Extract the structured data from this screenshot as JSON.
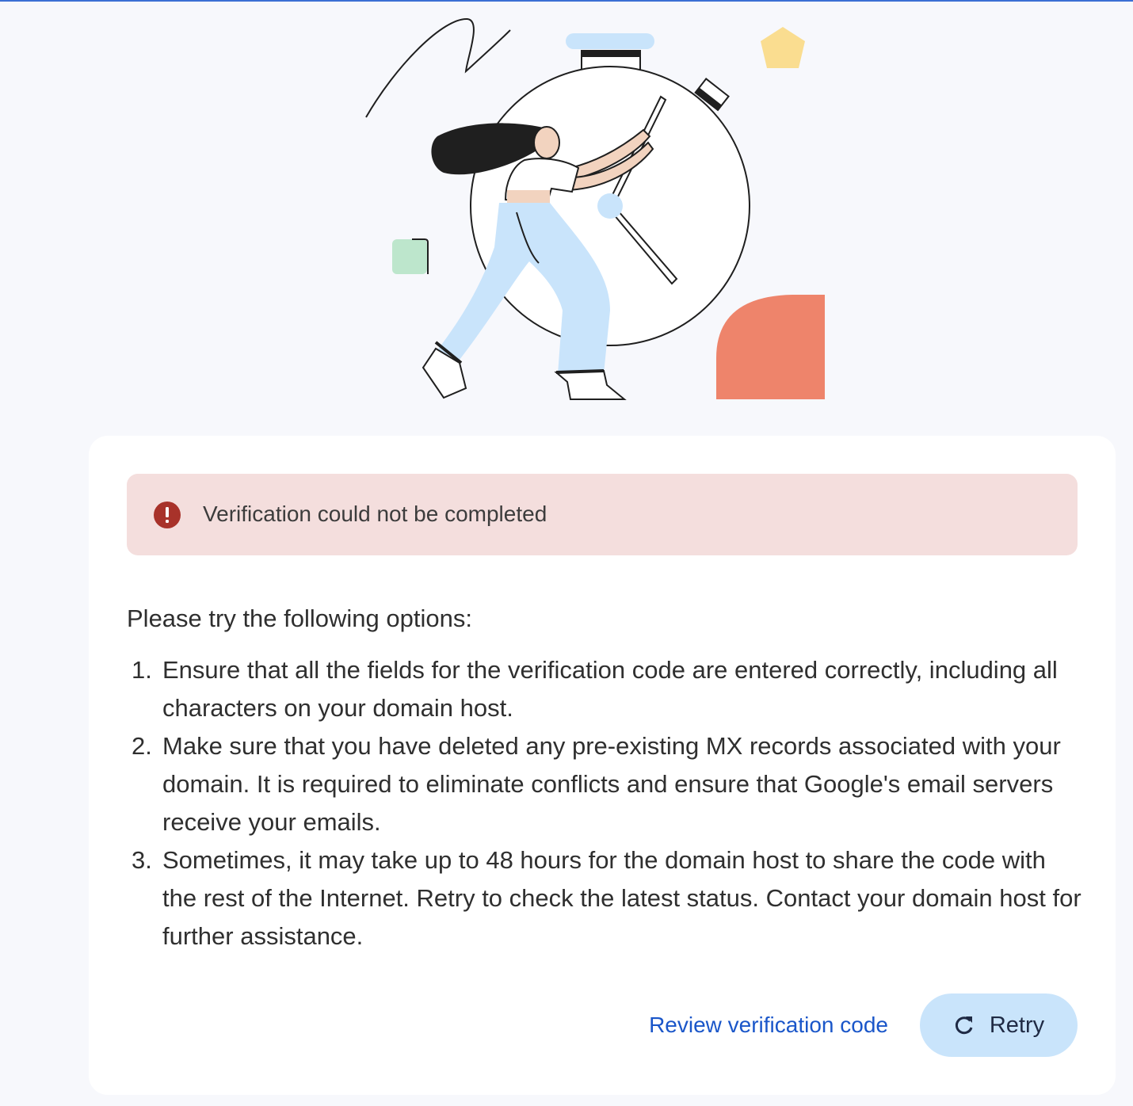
{
  "alert": {
    "message": "Verification could not be completed",
    "icon": "error-icon"
  },
  "content": {
    "intro": "Please try the following options:",
    "options": [
      {
        "number": "1.",
        "text": "Ensure that all the fields for the verification code are entered correctly, including all characters on your domain host."
      },
      {
        "number": "2.",
        "text": "Make sure that you have deleted any pre-existing MX records associated with your domain. It is required to eliminate conflicts and ensure that Google's email servers receive your emails."
      },
      {
        "number": "3.",
        "text": "Sometimes, it may take up to 48 hours for the domain host to share the code with the rest of the Internet. Retry to check the latest status. Contact your domain host for further assistance."
      }
    ]
  },
  "actions": {
    "review_label": "Review verification code",
    "retry_label": "Retry",
    "retry_icon": "refresh-icon"
  },
  "colors": {
    "page_background": "#f7f8fc",
    "card_background": "#ffffff",
    "alert_background": "#f4dedd",
    "error_red": "#a8322a",
    "link_blue": "#1a56c9",
    "retry_button_background": "#c9e4fb"
  }
}
